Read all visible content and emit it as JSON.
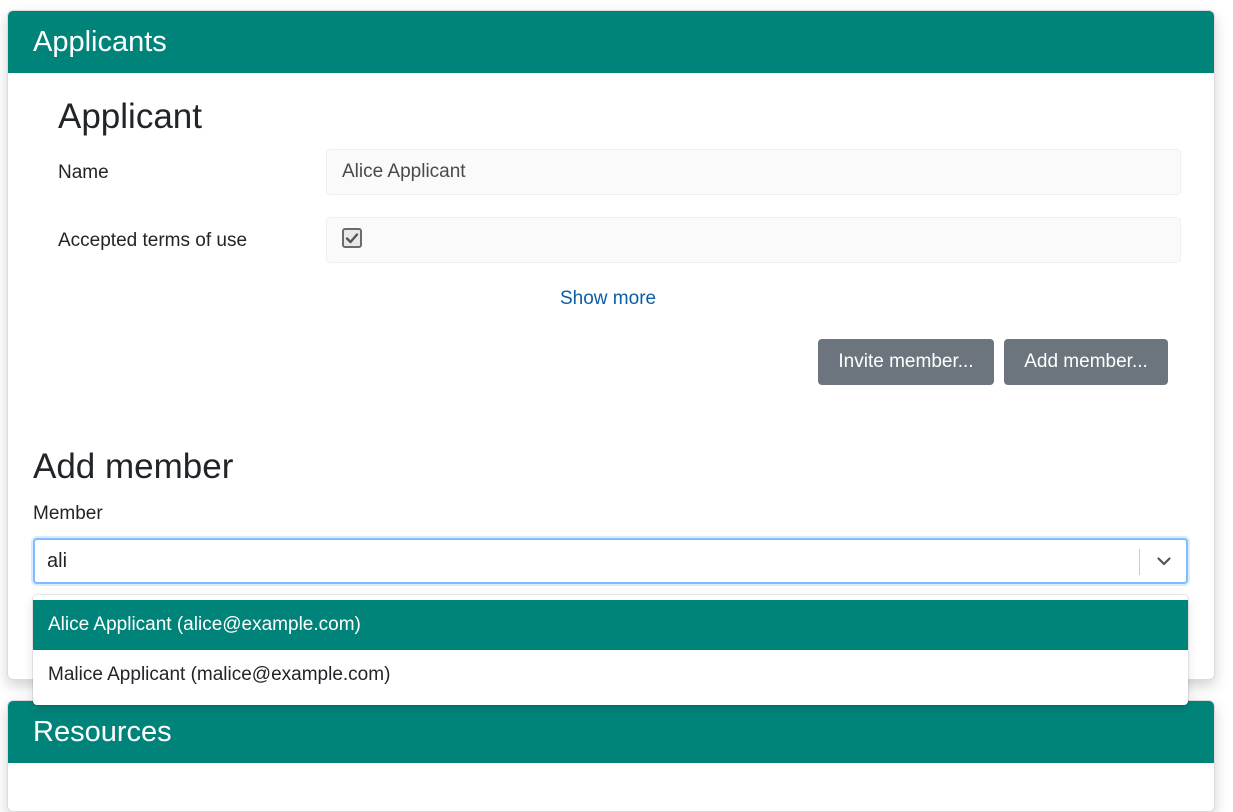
{
  "applicants": {
    "header": "Applicants",
    "applicant": {
      "title": "Applicant",
      "name_label": "Name",
      "name_value": "Alice Applicant",
      "terms_label": "Accepted terms of use",
      "terms_checked": true,
      "show_more": "Show more"
    },
    "buttons": {
      "invite": "Invite member...",
      "add": "Add member..."
    },
    "add_member": {
      "title": "Add member",
      "member_label": "Member",
      "input_value": "ali",
      "options": [
        "Alice Applicant (alice@example.com)",
        "Malice Applicant (malice@example.com)"
      ]
    }
  },
  "resources": {
    "header": "Resources"
  },
  "colors": {
    "header_bg": "#00847a",
    "button_bg": "#6c757d",
    "link": "#0b5ea6",
    "focus_border": "#80bdff"
  }
}
